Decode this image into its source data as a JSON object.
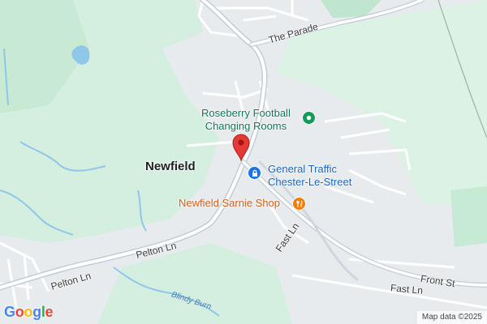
{
  "map": {
    "colors": {
      "land": "#e8ebee",
      "park": "#d7f0e2",
      "park_dark": "#bfe5cf",
      "road": "#ffffff",
      "road_major": "#c9d1da",
      "water": "#8fc7ea",
      "pin": "#e53935"
    },
    "place_label": "Newfield",
    "roads": {
      "the_parade": "The Parade",
      "pelton_ln": "Pelton Ln",
      "fast_ln_upper": "Fast Ln",
      "front_st": "Front St",
      "fast_ln_lower": "Fast Ln"
    },
    "water_label": "Blindy Burn",
    "pois": [
      {
        "line1": "Roseberry Football",
        "line2": "Changing Rooms",
        "icon": "green-place-icon"
      },
      {
        "line1": "General Traffic",
        "line2": "Chester-Le-Street",
        "icon": "blue-lock-icon"
      },
      {
        "line1": "Newfield Sarnie Shop",
        "line2": "",
        "icon": "orange-fork-knife-icon"
      }
    ],
    "marker": {
      "icon": "red-pin-icon"
    },
    "logo": {
      "letters": [
        "G",
        "o",
        "o",
        "g",
        "l",
        "e"
      ],
      "colors": [
        "#4285F4",
        "#EA4335",
        "#FBBC05",
        "#4285F4",
        "#34A853",
        "#EA4335"
      ]
    },
    "attribution": "Map data ©2025"
  }
}
